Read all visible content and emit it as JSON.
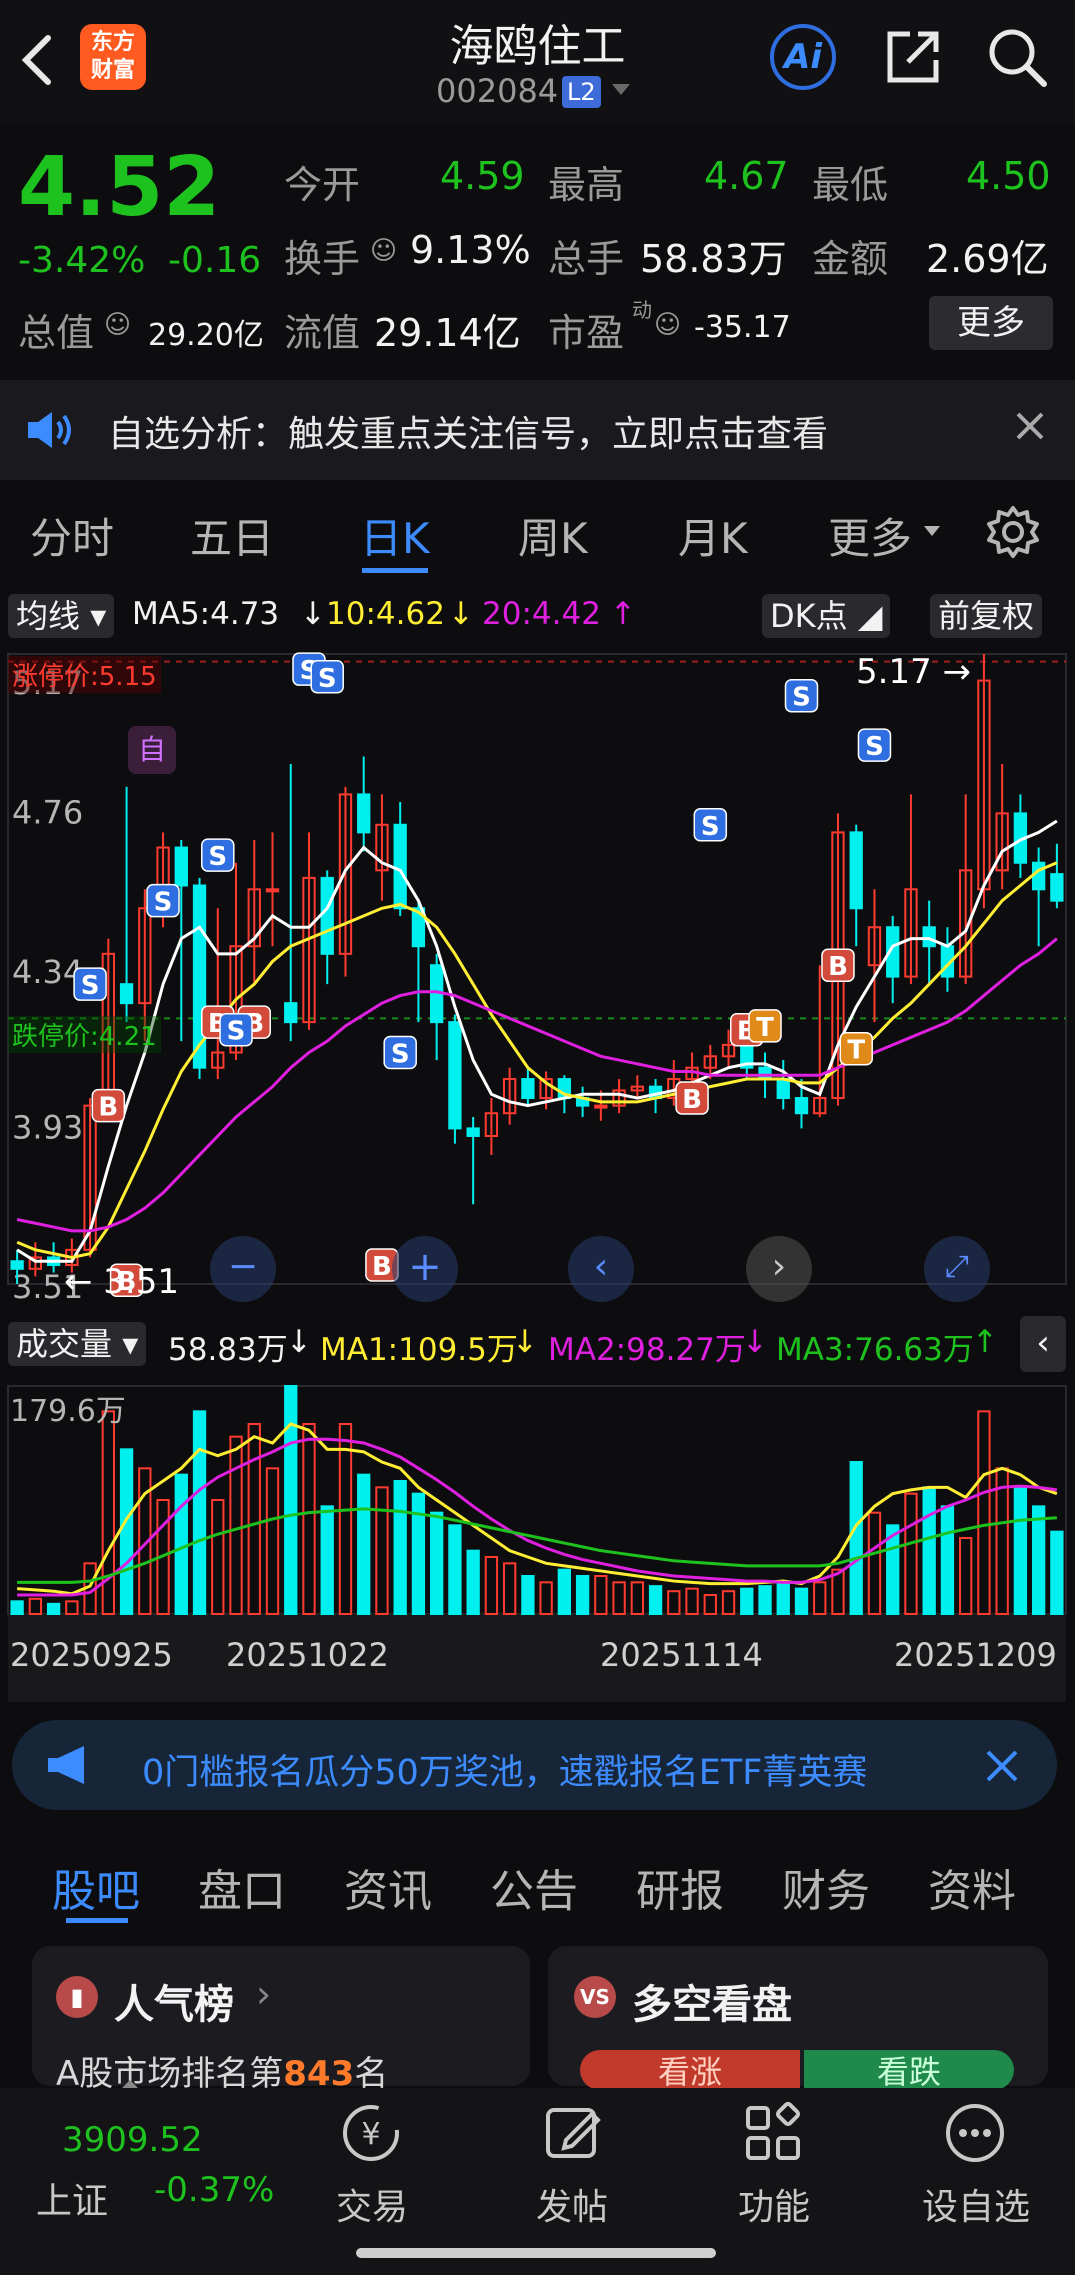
{
  "header": {
    "logo_text": "东方财富",
    "title": "海鸥住工",
    "code": "002084",
    "level": "L2",
    "ai_label": "Ai"
  },
  "quote": {
    "price": "4.52",
    "change_pct": "-3.42%",
    "change": "-0.16",
    "open_label": "今开",
    "open": "4.59",
    "high_label": "最高",
    "high": "4.67",
    "low_label": "最低",
    "low": "4.50",
    "turnover_label": "换手",
    "turnover": "9.13%",
    "volume_label": "总手",
    "volume": "58.83万",
    "amount_label": "金额",
    "amount": "2.69亿",
    "mktcap_label": "总值",
    "mktcap": "29.20亿",
    "float_label": "流值",
    "float": "29.14亿",
    "pe_label": "市盈",
    "pe_sup": "动",
    "pe": "-35.17",
    "more_label": "更多"
  },
  "banner": {
    "text": "自选分析：触发重点关注信号，立即点击查看"
  },
  "tabs": [
    "分时",
    "五日",
    "日K",
    "周K",
    "月K",
    "更多"
  ],
  "active_tab": "日K",
  "kline": {
    "ma_label": "均线",
    "ma5": "MA5:4.73",
    "ma10": "10:4.62",
    "ma20": "20:4.42",
    "dk_label": "DK点",
    "adj_label": "前复权",
    "limit_up": "涨停价:5.15",
    "limit_down": "跌停价:4.21",
    "high_marker": "5.17",
    "low_marker": "3.51",
    "self_tag": "自",
    "colors": {
      "ma5": "#ffffff",
      "ma10": "#ffee33",
      "ma20": "#e020e0",
      "up": "#ff3b30",
      "down": "#00f0f0"
    }
  },
  "volume": {
    "label": "成交量",
    "value": "58.83万",
    "ma1": "MA1:109.5万",
    "ma2": "MA2:98.27万",
    "ma3": "MA3:76.63万",
    "max_label": "179.6万",
    "dates": [
      "20250925",
      "20251022",
      "20251114",
      "20251209"
    ]
  },
  "chart_data": {
    "type": "candlestick",
    "y_ticks": [
      "5.17",
      "4.76",
      "4.34",
      "3.93",
      "3.51"
    ],
    "ylim": [
      3.51,
      5.17
    ],
    "candles": [
      {
        "o": 3.57,
        "c": 3.55,
        "h": 3.6,
        "l": 3.51
      },
      {
        "o": 3.55,
        "c": 3.58,
        "h": 3.62,
        "l": 3.53
      },
      {
        "o": 3.58,
        "c": 3.56,
        "h": 3.62,
        "l": 3.54
      },
      {
        "o": 3.56,
        "c": 3.6,
        "h": 3.63,
        "l": 3.54
      },
      {
        "o": 3.6,
        "c": 3.98,
        "h": 4.0,
        "l": 3.58
      },
      {
        "o": 3.98,
        "c": 4.38,
        "h": 4.42,
        "l": 3.96
      },
      {
        "o": 4.3,
        "c": 4.25,
        "h": 4.82,
        "l": 4.2
      },
      {
        "o": 4.25,
        "c": 4.5,
        "h": 4.55,
        "l": 4.15
      },
      {
        "o": 4.48,
        "c": 4.66,
        "h": 4.7,
        "l": 4.45
      },
      {
        "o": 4.66,
        "c": 4.56,
        "h": 4.68,
        "l": 4.15
      },
      {
        "o": 4.56,
        "c": 4.08,
        "h": 4.58,
        "l": 4.05
      },
      {
        "o": 4.08,
        "c": 4.12,
        "h": 4.5,
        "l": 4.05
      },
      {
        "o": 4.12,
        "c": 4.4,
        "h": 4.62,
        "l": 4.1
      },
      {
        "o": 4.4,
        "c": 4.55,
        "h": 4.68,
        "l": 4.3
      },
      {
        "o": 4.55,
        "c": 4.55,
        "h": 4.7,
        "l": 4.4
      },
      {
        "o": 4.25,
        "c": 4.2,
        "h": 4.88,
        "l": 4.15
      },
      {
        "o": 4.2,
        "c": 4.58,
        "h": 4.7,
        "l": 4.18
      },
      {
        "o": 4.58,
        "c": 4.38,
        "h": 4.6,
        "l": 4.3
      },
      {
        "o": 4.38,
        "c": 4.8,
        "h": 4.82,
        "l": 4.32
      },
      {
        "o": 4.8,
        "c": 4.7,
        "h": 4.9,
        "l": 4.65
      },
      {
        "o": 4.6,
        "c": 4.72,
        "h": 4.8,
        "l": 4.52
      },
      {
        "o": 4.72,
        "c": 4.5,
        "h": 4.78,
        "l": 4.48
      },
      {
        "o": 4.5,
        "c": 4.4,
        "h": 4.52,
        "l": 4.2
      },
      {
        "o": 4.35,
        "c": 4.2,
        "h": 4.38,
        "l": 4.1
      },
      {
        "o": 4.2,
        "c": 3.92,
        "h": 4.22,
        "l": 3.88
      },
      {
        "o": 3.92,
        "c": 3.9,
        "h": 3.95,
        "l": 3.72
      },
      {
        "o": 3.9,
        "c": 3.96,
        "h": 4.0,
        "l": 3.85
      },
      {
        "o": 3.96,
        "c": 4.05,
        "h": 4.08,
        "l": 3.93
      },
      {
        "o": 4.05,
        "c": 4.0,
        "h": 4.08,
        "l": 3.98
      },
      {
        "o": 4.0,
        "c": 4.05,
        "h": 4.07,
        "l": 3.97
      },
      {
        "o": 4.05,
        "c": 4.0,
        "h": 4.06,
        "l": 3.96
      },
      {
        "o": 4.0,
        "c": 3.98,
        "h": 4.03,
        "l": 3.95
      },
      {
        "o": 3.98,
        "c": 3.98,
        "h": 4.02,
        "l": 3.94
      },
      {
        "o": 3.98,
        "c": 4.02,
        "h": 4.05,
        "l": 3.96
      },
      {
        "o": 4.02,
        "c": 4.03,
        "h": 4.06,
        "l": 4.0
      },
      {
        "o": 4.03,
        "c": 4.0,
        "h": 4.05,
        "l": 3.96
      },
      {
        "o": 4.0,
        "c": 4.05,
        "h": 4.1,
        "l": 3.98
      },
      {
        "o": 4.05,
        "c": 4.08,
        "h": 4.12,
        "l": 4.02
      },
      {
        "o": 4.08,
        "c": 4.11,
        "h": 4.14,
        "l": 4.05
      },
      {
        "o": 4.11,
        "c": 4.14,
        "h": 4.18,
        "l": 4.08
      },
      {
        "o": 4.14,
        "c": 4.08,
        "h": 4.2,
        "l": 4.05
      },
      {
        "o": 4.08,
        "c": 4.05,
        "h": 4.12,
        "l": 4.0
      },
      {
        "o": 4.05,
        "c": 4.0,
        "h": 4.1,
        "l": 3.97
      },
      {
        "o": 4.0,
        "c": 3.96,
        "h": 4.05,
        "l": 3.92
      },
      {
        "o": 3.96,
        "c": 4.0,
        "h": 4.35,
        "l": 3.95
      },
      {
        "o": 4.0,
        "c": 4.7,
        "h": 4.75,
        "l": 3.98
      },
      {
        "o": 4.7,
        "c": 4.5,
        "h": 4.72,
        "l": 4.4
      },
      {
        "o": 4.35,
        "c": 4.45,
        "h": 4.55,
        "l": 4.2
      },
      {
        "o": 4.45,
        "c": 4.32,
        "h": 4.48,
        "l": 4.25
      },
      {
        "o": 4.32,
        "c": 4.55,
        "h": 4.8,
        "l": 4.3
      },
      {
        "o": 4.45,
        "c": 4.4,
        "h": 4.52,
        "l": 4.3
      },
      {
        "o": 4.4,
        "c": 4.32,
        "h": 4.45,
        "l": 4.28
      },
      {
        "o": 4.32,
        "c": 4.6,
        "h": 4.8,
        "l": 4.3
      },
      {
        "o": 4.55,
        "c": 5.1,
        "h": 5.17,
        "l": 4.5
      },
      {
        "o": 4.6,
        "c": 4.75,
        "h": 4.88,
        "l": 4.55
      },
      {
        "o": 4.75,
        "c": 4.62,
        "h": 4.8,
        "l": 4.58
      },
      {
        "o": 4.62,
        "c": 4.55,
        "h": 4.66,
        "l": 4.4
      },
      {
        "o": 4.59,
        "c": 4.52,
        "h": 4.67,
        "l": 4.5
      }
    ],
    "ma5": [
      3.6,
      3.57,
      3.57,
      3.57,
      3.65,
      3.82,
      3.98,
      4.12,
      4.3,
      4.42,
      4.45,
      4.38,
      4.38,
      4.42,
      4.48,
      4.45,
      4.45,
      4.5,
      4.6,
      4.66,
      4.62,
      4.6,
      4.52,
      4.4,
      4.24,
      4.1,
      4.01,
      3.99,
      3.98,
      3.99,
      4.0,
      4.01,
      4.01,
      4.01,
      4.0,
      4.01,
      4.02,
      4.04,
      4.06,
      4.08,
      4.09,
      4.09,
      4.07,
      4.03,
      4.01,
      4.14,
      4.24,
      4.32,
      4.4,
      4.42,
      4.42,
      4.4,
      4.44,
      4.56,
      4.65,
      4.68,
      4.7,
      4.73
    ],
    "ma10": [
      3.62,
      3.6,
      3.59,
      3.58,
      3.59,
      3.66,
      3.76,
      3.86,
      3.97,
      4.07,
      4.14,
      4.2,
      4.26,
      4.3,
      4.36,
      4.4,
      4.42,
      4.44,
      4.46,
      4.48,
      4.5,
      4.51,
      4.49,
      4.45,
      4.38,
      4.3,
      4.22,
      4.15,
      4.08,
      4.04,
      4.01,
      4.0,
      3.99,
      3.99,
      3.99,
      4.0,
      4.01,
      4.02,
      4.03,
      4.04,
      4.05,
      4.05,
      4.05,
      4.04,
      4.04,
      4.08,
      4.12,
      4.16,
      4.21,
      4.25,
      4.3,
      4.35,
      4.4,
      4.46,
      4.52,
      4.56,
      4.6,
      4.62
    ],
    "ma20": [
      3.68,
      3.67,
      3.66,
      3.65,
      3.65,
      3.66,
      3.68,
      3.71,
      3.75,
      3.8,
      3.85,
      3.9,
      3.95,
      3.99,
      4.03,
      4.08,
      4.12,
      4.15,
      4.19,
      4.22,
      4.25,
      4.27,
      4.28,
      4.28,
      4.27,
      4.25,
      4.23,
      4.21,
      4.19,
      4.17,
      4.15,
      4.13,
      4.11,
      4.1,
      4.09,
      4.08,
      4.07,
      4.07,
      4.06,
      4.06,
      4.06,
      4.06,
      4.06,
      4.06,
      4.06,
      4.08,
      4.1,
      4.12,
      4.14,
      4.16,
      4.18,
      4.2,
      4.23,
      4.27,
      4.31,
      4.35,
      4.38,
      4.42
    ],
    "signals": [
      {
        "i": 8,
        "t": "S",
        "p": 4.52
      },
      {
        "i": 4,
        "t": "S",
        "p": 4.3
      },
      {
        "i": 5,
        "t": "B",
        "p": 3.98
      },
      {
        "i": 6,
        "t": "B",
        "p": 3.52
      },
      {
        "i": 11,
        "t": "S",
        "p": 4.64
      },
      {
        "i": 11,
        "t": "B",
        "p": 4.2
      },
      {
        "i": 13,
        "t": "B",
        "p": 4.2
      },
      {
        "i": 12,
        "t": "S",
        "p": 4.18
      },
      {
        "i": 16,
        "t": "S",
        "p": 5.13
      },
      {
        "i": 17,
        "t": "S",
        "p": 5.11
      },
      {
        "i": 21,
        "t": "S",
        "p": 4.12
      },
      {
        "i": 20,
        "t": "B",
        "p": 3.56
      },
      {
        "i": 37,
        "t": "B",
        "p": 4.0
      },
      {
        "i": 38,
        "t": "S",
        "p": 4.72
      },
      {
        "i": 40,
        "t": "B",
        "p": 4.18
      },
      {
        "i": 41,
        "t": "T",
        "p": 4.19
      },
      {
        "i": 43,
        "t": "S",
        "p": 5.06
      },
      {
        "i": 45,
        "t": "B",
        "p": 4.35
      },
      {
        "i": 46,
        "t": "T",
        "p": 4.13
      },
      {
        "i": 47,
        "t": "S",
        "p": 4.93
      }
    ],
    "volumes": [
      10,
      12,
      8,
      10,
      40,
      160,
      130,
      115,
      90,
      110,
      160,
      90,
      140,
      150,
      115,
      180,
      150,
      85,
      150,
      110,
      100,
      105,
      95,
      80,
      70,
      50,
      45,
      40,
      30,
      25,
      35,
      30,
      30,
      25,
      25,
      22,
      18,
      20,
      15,
      18,
      20,
      22,
      25,
      20,
      25,
      35,
      120,
      80,
      70,
      95,
      100,
      85,
      60,
      160,
      115,
      100,
      85,
      65
    ],
    "vol_ma1": [
      20,
      19,
      18,
      16,
      22,
      50,
      75,
      95,
      105,
      115,
      130,
      125,
      130,
      140,
      135,
      150,
      145,
      130,
      130,
      128,
      120,
      115,
      100,
      90,
      80,
      70,
      60,
      50,
      45,
      40,
      38,
      36,
      34,
      32,
      30,
      28,
      26,
      25,
      24,
      24,
      24,
      25,
      26,
      24,
      30,
      45,
      70,
      85,
      95,
      98,
      100,
      100,
      92,
      110,
      115,
      110,
      100,
      95
    ],
    "vol_ma2": [
      15,
      15,
      15,
      15,
      17,
      28,
      40,
      55,
      70,
      85,
      98,
      108,
      115,
      122,
      128,
      135,
      138,
      138,
      137,
      135,
      130,
      124,
      115,
      106,
      96,
      85,
      75,
      66,
      58,
      52,
      47,
      43,
      40,
      37,
      34,
      32,
      30,
      29,
      28,
      27,
      26,
      26,
      25,
      25,
      27,
      32,
      42,
      52,
      62,
      70,
      78,
      85,
      90,
      96,
      100,
      101,
      100,
      98
    ],
    "vol_ma3": [
      25,
      25,
      25,
      25,
      26,
      30,
      35,
      40,
      46,
      52,
      58,
      63,
      67,
      71,
      75,
      78,
      80,
      81,
      82,
      83,
      82,
      81,
      79,
      77,
      74,
      71,
      68,
      65,
      62,
      59,
      56,
      53,
      50,
      48,
      46,
      44,
      42,
      41,
      40,
      39,
      38,
      38,
      38,
      38,
      38,
      40,
      44,
      48,
      52,
      56,
      60,
      64,
      67,
      70,
      72,
      74,
      75,
      76
    ]
  },
  "ad": {
    "text": "0门槛报名瓜分50万奖池，速戳报名ETF菁英赛"
  },
  "bottom_tabs": [
    "股吧",
    "盘口",
    "资讯",
    "公告",
    "研报",
    "财务",
    "资料"
  ],
  "cards": {
    "hot_title": "人气榜",
    "hot_rank_prefix": "A股市场排名第",
    "hot_rank": "843",
    "hot_rank_suffix": "名",
    "dk_title": "多空看盘",
    "bull": "看涨",
    "bear": "看跌"
  },
  "footer": {
    "index_value": "3909.52",
    "index_name": "上证",
    "index_change": "-0.37%",
    "trade": "交易",
    "post": "发帖",
    "func": "功能",
    "watch": "设自选"
  }
}
